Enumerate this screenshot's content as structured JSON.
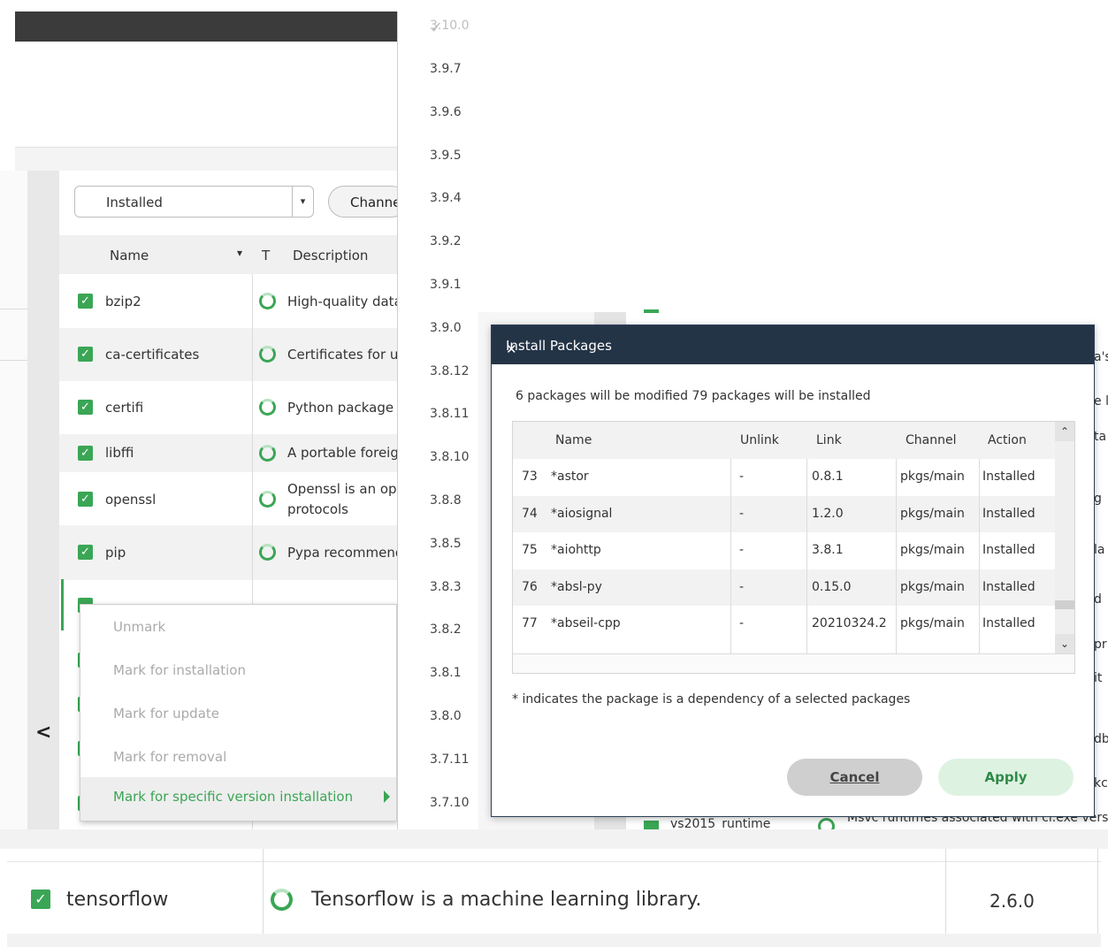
{
  "navigator": {
    "filter_value": "Installed",
    "channels_label": "Channels",
    "columns": {
      "name": "Name",
      "type": "T",
      "description": "Description"
    },
    "packages": [
      {
        "name": "bzip2",
        "description": "High-quality data compressor"
      },
      {
        "name": "ca-certificates",
        "description": "Certificates for use with other packages"
      },
      {
        "name": "certifi",
        "description": "Python package for providing Mozilla's CA Bundle"
      },
      {
        "name": "libffi",
        "description": "A portable foreign function interface library"
      },
      {
        "name": "openssl",
        "description": "Openssl is an open-source implementation of the ssl and tls",
        "description2": "protocols"
      },
      {
        "name": "pip",
        "description": "Pypa recommended tool for installing python packages"
      }
    ]
  },
  "context_menu": {
    "items": [
      "Unmark",
      "Mark for installation",
      "Mark for update",
      "Mark for removal"
    ],
    "selected": "Mark for specific version installation"
  },
  "version_list": {
    "current": "3.10.0",
    "versions": [
      "3.9.7",
      "3.9.6",
      "3.9.5",
      "3.9.4",
      "3.9.2",
      "3.9.1",
      "3.9.0",
      "3.8.12",
      "3.8.11",
      "3.8.10",
      "3.8.8",
      "3.8.5",
      "3.8.3",
      "3.8.2",
      "3.8.1",
      "3.8.0",
      "3.7.11",
      "3.7.10"
    ]
  },
  "background_app": {
    "partial_row_name": "vs2015_runtime",
    "partial_row_desc": "Msvc runtimes associated with cl.exe version"
  },
  "dialog": {
    "title": "Install Packages",
    "summary": "6 packages will be modified 79 packages will be installed",
    "columns": [
      "Name",
      "Unlink",
      "Link",
      "Channel",
      "Action"
    ],
    "rows": [
      {
        "idx": "73",
        "name": "*astor",
        "unlink": "-",
        "link": "0.8.1",
        "channel": "pkgs/main",
        "action": "Installed"
      },
      {
        "idx": "74",
        "name": "*aiosignal",
        "unlink": "-",
        "link": "1.2.0",
        "channel": "pkgs/main",
        "action": "Installed"
      },
      {
        "idx": "75",
        "name": "*aiohttp",
        "unlink": "-",
        "link": "3.8.1",
        "channel": "pkgs/main",
        "action": "Installed"
      },
      {
        "idx": "76",
        "name": "*absl-py",
        "unlink": "-",
        "link": "0.15.0",
        "channel": "pkgs/main",
        "action": "Installed"
      },
      {
        "idx": "77",
        "name": "*abseil-cpp",
        "unlink": "-",
        "link": "20210324.2",
        "channel": "pkgs/main",
        "action": "Installed"
      }
    ],
    "note": "* indicates the package is a dependency of a selected packages",
    "cancel_label": "Cancel",
    "apply_label": "Apply"
  },
  "bottom_row": {
    "name": "tensorflow",
    "description": "Tensorflow is a machine learning library.",
    "version": "2.6.0"
  },
  "icons": {
    "check": "✓",
    "close": "✕",
    "chevron_down": "⌄",
    "chevron_up": "⌃",
    "back": "<"
  },
  "colors": {
    "accent_green": "#3aa655",
    "dialog_title_bg": "#243447",
    "topbar_bg": "#3b3b3b"
  }
}
